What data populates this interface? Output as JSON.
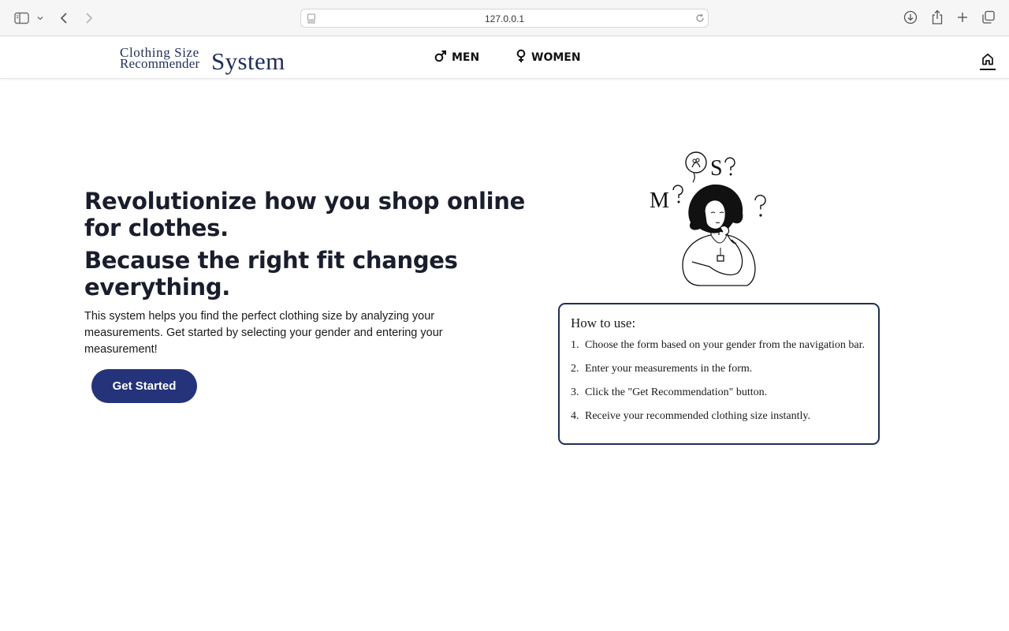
{
  "browser": {
    "url": "127.0.0.1"
  },
  "navbar": {
    "logo": {
      "line1": "Clothing Size",
      "line2": "Recommender",
      "line3": "System"
    },
    "links": [
      {
        "label": "MEN",
        "icon": "male-icon"
      },
      {
        "label": "WOMEN",
        "icon": "female-icon"
      }
    ],
    "home_icon": "home-icon"
  },
  "hero": {
    "title": "Revolutionize how you shop online for clothes.",
    "subtitle": "Because the right fit changes everything.",
    "description": "This system helps you find the perfect clothing size by analyzing your measurements. Get started by selecting your gender and entering your measurement!",
    "cta_label": "Get Started",
    "cta_color": "#25337a"
  },
  "illustration": {
    "letters": [
      "M",
      "S"
    ]
  },
  "how_to_use": {
    "title": "How to use:",
    "steps": [
      {
        "num": "1.",
        "text": "Choose the form based on your gender from the navigation bar."
      },
      {
        "num": "2.",
        "text": "Enter your measurements in the form."
      },
      {
        "num": "3.",
        "text": "Click the \"Get Recommendation\" button."
      },
      {
        "num": "4.",
        "text": "Receive your recommended clothing size instantly."
      }
    ],
    "border_color": "#1f2d5a"
  }
}
